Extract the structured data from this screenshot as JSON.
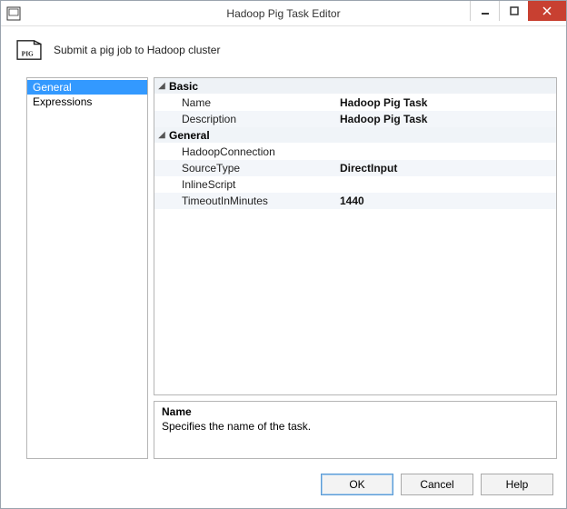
{
  "window": {
    "title": "Hadoop Pig Task Editor",
    "subtitle": "Submit a pig job to Hadoop cluster"
  },
  "sidebar": {
    "items": [
      {
        "label": "General"
      },
      {
        "label": "Expressions"
      }
    ]
  },
  "props": {
    "categories": [
      {
        "label": "Basic",
        "items": [
          {
            "label": "Name",
            "value": "Hadoop Pig Task"
          },
          {
            "label": "Description",
            "value": "Hadoop Pig Task"
          }
        ]
      },
      {
        "label": "General",
        "items": [
          {
            "label": "HadoopConnection",
            "value": ""
          },
          {
            "label": "SourceType",
            "value": "DirectInput"
          },
          {
            "label": "InlineScript",
            "value": ""
          },
          {
            "label": "TimeoutInMinutes",
            "value": "1440"
          }
        ]
      }
    ]
  },
  "description": {
    "title": "Name",
    "text": "Specifies the name of the task."
  },
  "buttons": {
    "ok": "OK",
    "cancel": "Cancel",
    "help": "Help"
  }
}
